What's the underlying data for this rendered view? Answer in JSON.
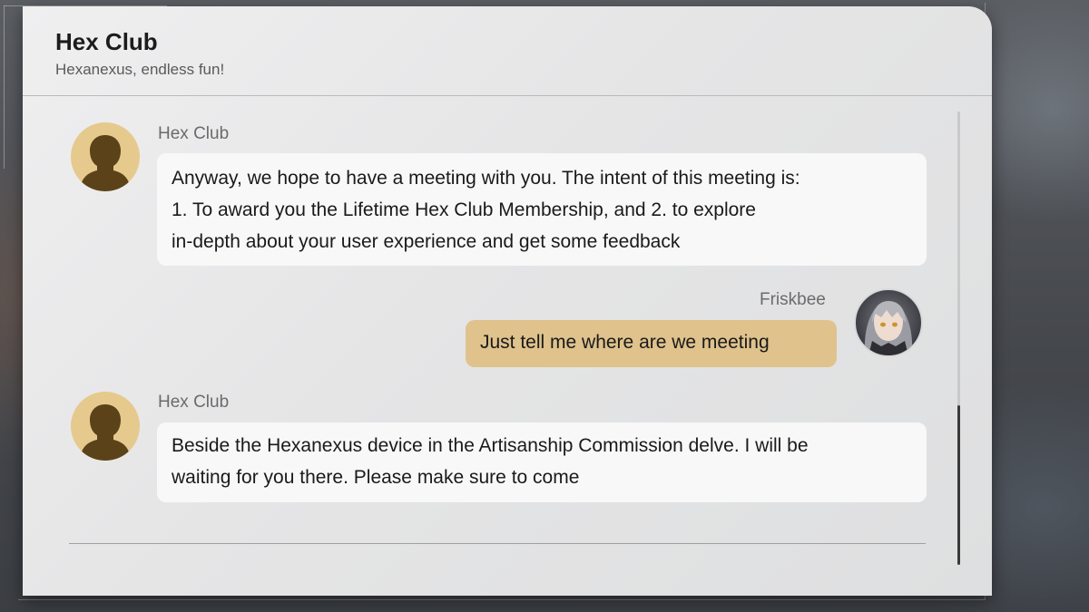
{
  "header": {
    "title": "Hex Club",
    "subtitle": "Hexanexus, endless fun!"
  },
  "messages": [
    {
      "sender": "Hex Club",
      "avatar_icon": "silhouette-avatar-icon",
      "lines": [
        "Anyway, we hope to have a meeting with you. The intent of this meeting is:",
        "1. To award you the Lifetime Hex Club Membership, and 2. to explore",
        "in-depth about your user experience and get some feedback"
      ]
    },
    {
      "sender": "Friskbee",
      "avatar_icon": "character-portrait-avatar-icon",
      "lines": [
        "Just tell me where are we meeting"
      ]
    },
    {
      "sender": "Hex Club",
      "avatar_icon": "silhouette-avatar-icon",
      "lines": [
        "Beside the Hexanexus device in the Artisanship Commission delve. I will be",
        "waiting for you there. Please make sure to come"
      ]
    }
  ],
  "colors": {
    "panel_background": "#e6e6e7",
    "incoming_bubble": "#f8f8f8",
    "outgoing_bubble": "#dfc28c",
    "avatar_gold": "#e6c98d",
    "avatar_silhouette": "#5b4218"
  }
}
